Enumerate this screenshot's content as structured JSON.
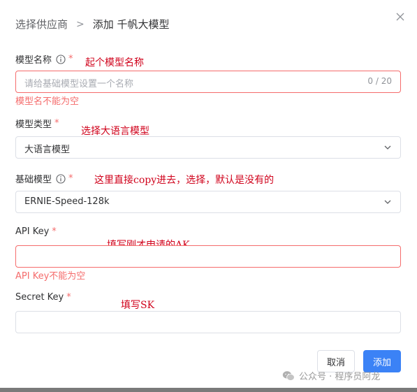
{
  "breadcrumb": {
    "parent": "选择供应商",
    "separator": ">",
    "current": "添加 千帆大模型"
  },
  "form": {
    "model_name": {
      "label": "模型名称",
      "required_mark": "*",
      "placeholder": "请给基础模型设置一个名称",
      "counter": "0 / 20",
      "error": "模型名不能为空"
    },
    "model_type": {
      "label": "模型类型",
      "required_mark": "*",
      "value": "大语言模型"
    },
    "base_model": {
      "label": "基础模型",
      "required_mark": "*",
      "value": "ERNIE-Speed-128k"
    },
    "api_key": {
      "label": "API Key",
      "required_mark": "*",
      "error": "API Key不能为空"
    },
    "secret_key": {
      "label": "Secret Key",
      "required_mark": "*"
    }
  },
  "annotations": {
    "model_name": "起个模型名称",
    "model_type": "选择大语言模型",
    "base_model": "这里直接copy进去，选择，默认是没有的",
    "api_key": "填写刚才申请的AK",
    "secret_key": "填写SK"
  },
  "buttons": {
    "cancel": "取消",
    "add": "添加"
  },
  "watermark": "公众号 · 程序员阿龙",
  "colors": {
    "primary": "#3b82f6",
    "error": "#f56c6c",
    "annotation": "#d0021b"
  },
  "icons": {
    "close": "close-icon",
    "info": "info-icon",
    "chevron": "chevron-down-icon",
    "wechat": "wechat-icon"
  }
}
